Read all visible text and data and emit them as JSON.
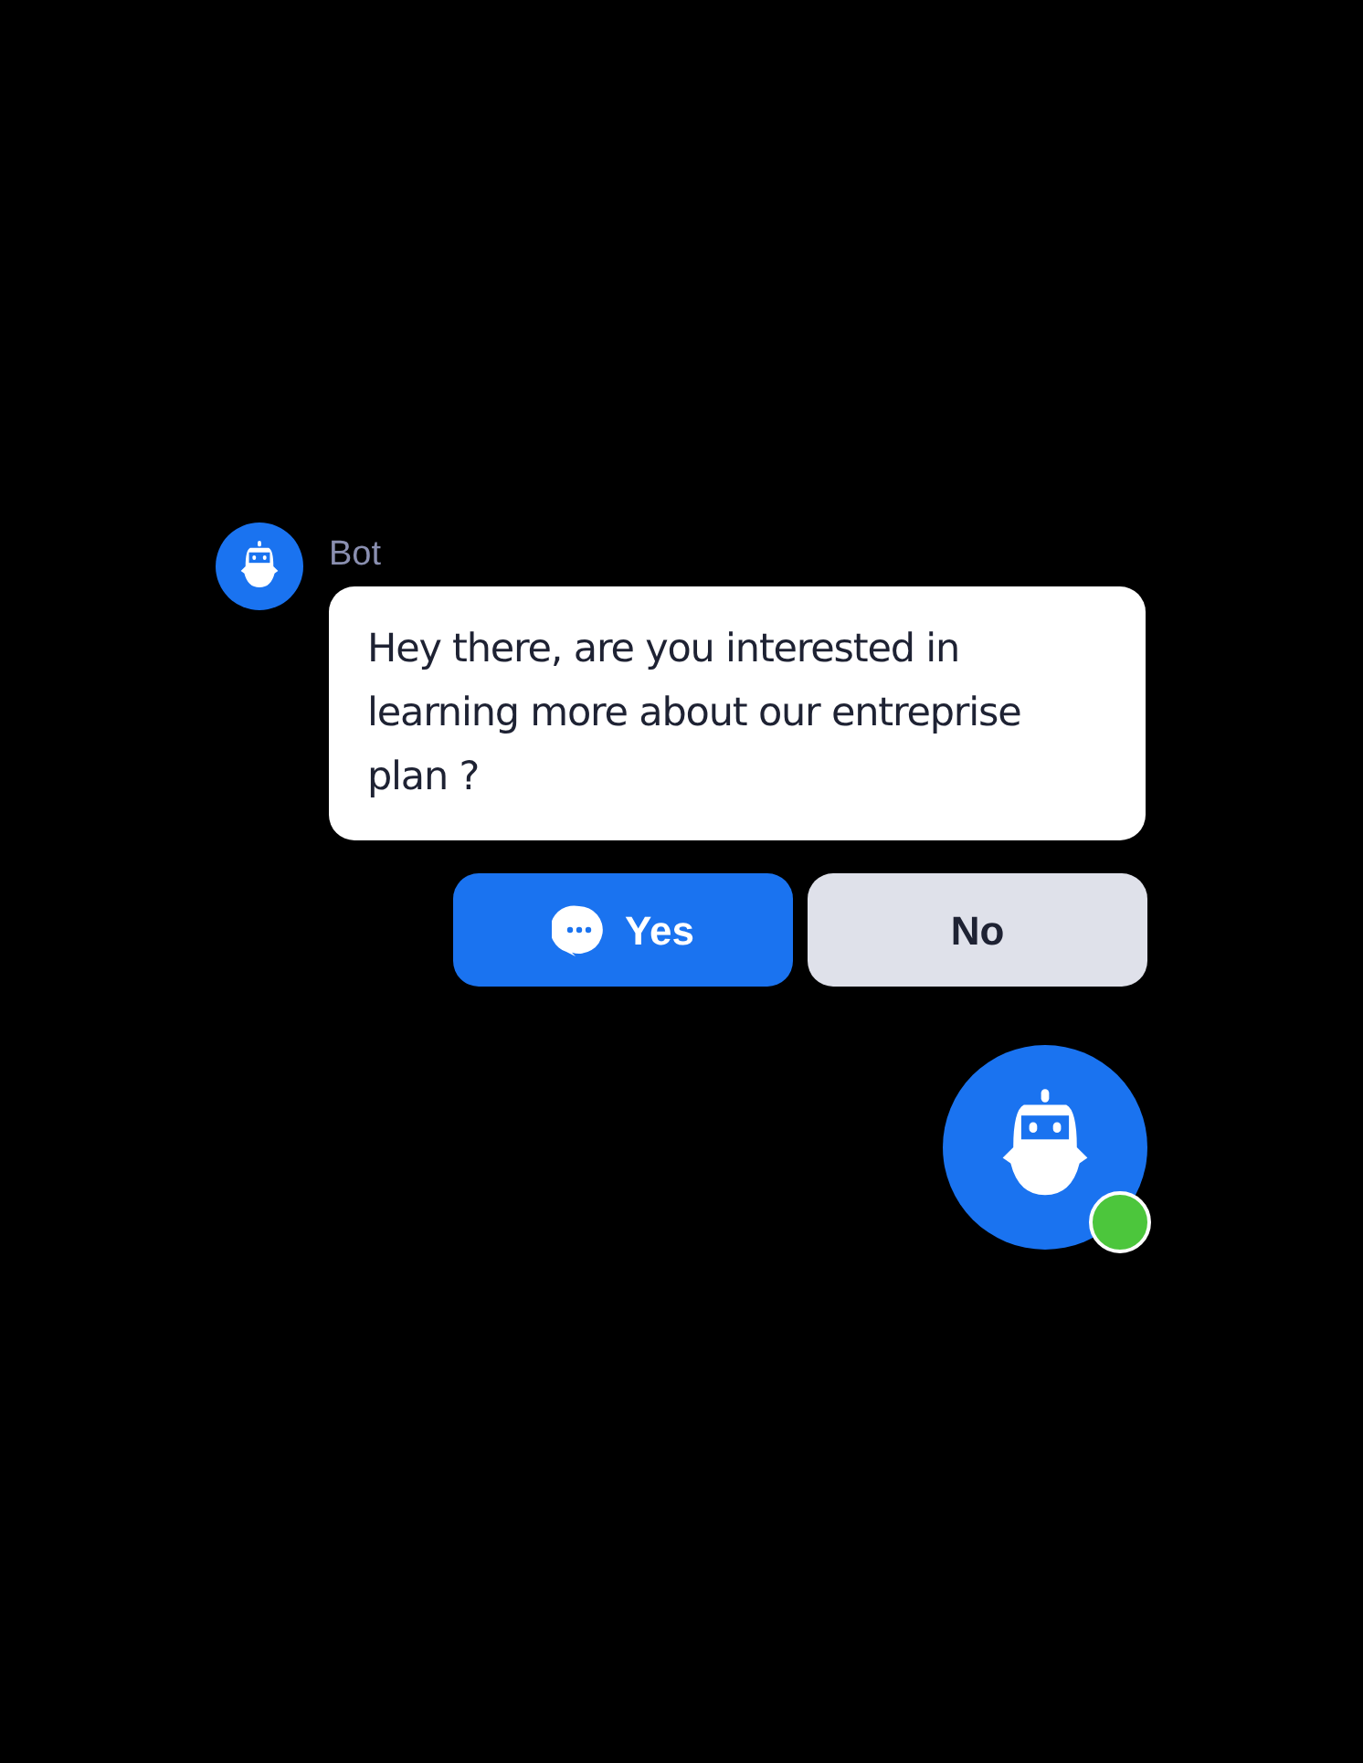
{
  "message": {
    "sender": "Bot",
    "text": "Hey there, are you interested in learning more about our entreprise plan ?"
  },
  "replies": [
    {
      "label": "Yes",
      "kind": "primary"
    },
    {
      "label": "No",
      "kind": "secondary"
    }
  ],
  "launcher": {
    "online": true
  }
}
